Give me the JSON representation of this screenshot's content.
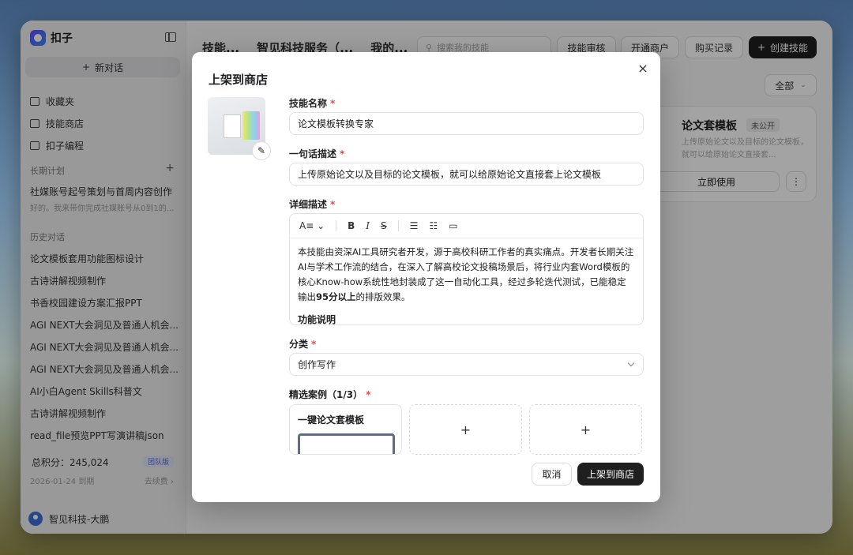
{
  "app": {
    "name": "扣子"
  },
  "sidebar": {
    "new_chat": "新对话",
    "nav": [
      {
        "label": "收藏夹",
        "icon": "folder-icon"
      },
      {
        "label": "技能商店",
        "icon": "books-icon"
      },
      {
        "label": "扣子编程",
        "icon": "code-file-icon"
      }
    ],
    "long_plan_title": "长期计划",
    "long_plan_item": {
      "title": "社媒账号起号策划与首周内容创作",
      "sub": "好的。我来带你完成社媒账号从0到1的..."
    },
    "history_title": "历史对话",
    "history": [
      "论文模板套用功能图标设计",
      "古诗讲解视频制作",
      "书香校园建设方案汇报PPT",
      "AGI NEXT大会洞见及普通人机会...",
      "AGI NEXT大会洞见及普通人机会...",
      "AGI NEXT大会洞见及普通人机会...",
      "AI小白Agent Skills科普文",
      "古诗讲解视频制作",
      "read_file预览PPT写演讲稿json"
    ],
    "points": "总积分：245,024",
    "team_badge": "团队版",
    "expire": "2026-01-24 到期",
    "renew": "去续费 ›",
    "user": "智见科技-大鹏"
  },
  "header": {
    "tabs": [
      "技能...",
      "智见科技服务（...",
      "我的..."
    ],
    "search_placeholder": "搜索我的技能",
    "buttons": {
      "review": "技能审核",
      "merchant": "开通商户",
      "purchase": "购买记录",
      "create": "创建技能"
    }
  },
  "filter": {
    "selected": "全部"
  },
  "skill_card": {
    "title": "论文套模板",
    "badge": "未公开",
    "desc": "上传原始论文以及目标的论文模板，就可以给原始论文直接套...",
    "use": "立即使用",
    "more": "⋮"
  },
  "modal": {
    "title": "上架到商店",
    "close": "×",
    "name_label": "技能名称",
    "name_value": "论文模板转换专家",
    "oneline_label": "一句话描述",
    "oneline_value": "上传原始论文以及目标的论文模板，就可以给原始论文直接套上论文模板",
    "detail_label": "详细描述",
    "detail_text_1": "本技能由资深AI工具研究者开发，源于高校科研工作者的真实痛点。开发者长期关注AI与学术工作流的结合，在深入了解高校论文投稿场景后，将行业内套Word模板的核心Know-how系统性地封装成了这一自动化工具，经过多轮迭代测试，已能稳定输出",
    "detail_bold": "95分以上",
    "detail_text_2": "的排版效果。",
    "detail_heading": "功能说明",
    "category_label": "分类",
    "category_value": "创作写作",
    "cases_label": "精选案例（1/3）",
    "case_title": "一键论文套模板",
    "case_add": "+",
    "cancel": "取消",
    "submit": "上架到商店"
  }
}
